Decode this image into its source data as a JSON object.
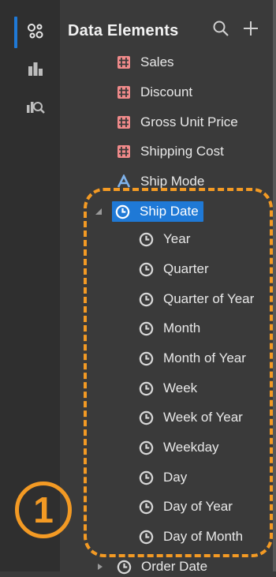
{
  "panel": {
    "title": "Data Elements"
  },
  "measures": [
    {
      "label": "Sales"
    },
    {
      "label": "Discount"
    },
    {
      "label": "Gross Unit Price"
    },
    {
      "label": "Shipping Cost"
    }
  ],
  "attribute": {
    "label": "Ship Mode"
  },
  "ship_date": {
    "label": "Ship Date",
    "children": [
      {
        "label": "Year"
      },
      {
        "label": "Quarter"
      },
      {
        "label": "Quarter of Year"
      },
      {
        "label": "Month"
      },
      {
        "label": "Month of Year"
      },
      {
        "label": "Week"
      },
      {
        "label": "Week of Year"
      },
      {
        "label": "Weekday"
      },
      {
        "label": "Day"
      },
      {
        "label": "Day of Year"
      },
      {
        "label": "Day of Month"
      }
    ]
  },
  "order_date": {
    "label": "Order Date"
  },
  "callout": {
    "number": "1"
  },
  "colors": {
    "background": "#3a3a3a",
    "rail": "#2f2f2f",
    "accent_blue": "#1f79d6",
    "measure_pink": "#f08a8a",
    "callout_orange": "#f39a24"
  },
  "icons": {
    "rail": [
      "data-elements-icon",
      "chart-icon",
      "chart-search-icon"
    ],
    "header": [
      "search-icon",
      "add-icon"
    ],
    "measure": "hash-icon",
    "attribute": "text-attribute-icon",
    "time": "clock-icon"
  }
}
